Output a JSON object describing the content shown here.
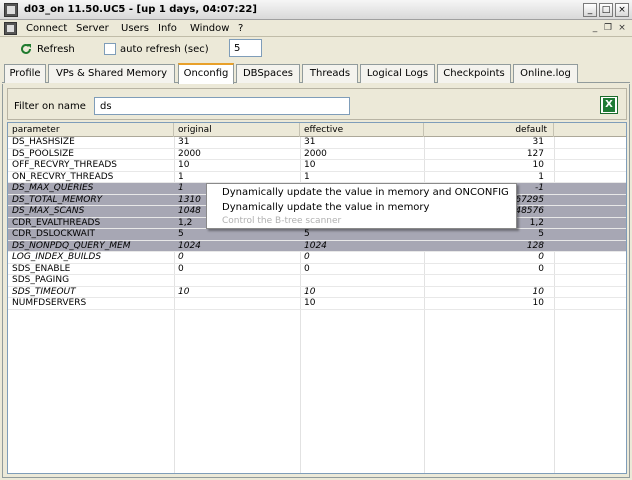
{
  "window": {
    "title": "d03_on 11.50.UC5 - [up 1 days, 04:07:22]"
  },
  "menu": [
    "Connect",
    "Server",
    "Users",
    "Info",
    "Window",
    "?"
  ],
  "toolbar": {
    "refresh_label": "Refresh",
    "auto_refresh_label": "auto refresh (sec)",
    "interval_value": "5"
  },
  "tabs": [
    "Profile",
    "VPs & Shared Memory",
    "Onconfig",
    "DBSpaces",
    "Threads",
    "Logical Logs",
    "Checkpoints",
    "Online.log"
  ],
  "active_tab": "Onconfig",
  "filter": {
    "label": "Filter on name",
    "value": "ds"
  },
  "table": {
    "headers": [
      "parameter",
      "original",
      "effective",
      "default"
    ],
    "rows": [
      [
        "DS_HASHSIZE",
        "31",
        "31",
        "31"
      ],
      [
        "DS_POOLSIZE",
        "2000",
        "2000",
        "127"
      ],
      [
        "OFF_RECVRY_THREADS",
        "10",
        "10",
        "10"
      ],
      [
        "ON_RECVRY_THREADS",
        "1",
        "1",
        "1"
      ],
      [
        "DS_MAX_QUERIES",
        "1",
        "",
        "-1"
      ],
      [
        "DS_TOTAL_MEMORY",
        "1310",
        "",
        "67295"
      ],
      [
        "DS_MAX_SCANS",
        "1048",
        "",
        "48576"
      ],
      [
        "CDR_EVALTHREADS",
        "1,2",
        "",
        "1,2"
      ],
      [
        "CDR_DSLOCKWAIT",
        "5",
        "5",
        "5"
      ],
      [
        "DS_NONPDQ_QUERY_MEM",
        "1024",
        "1024",
        "128"
      ],
      [
        "LOG_INDEX_BUILDS",
        "0",
        "0",
        "0"
      ],
      [
        "SDS_ENABLE",
        "0",
        "0",
        "0"
      ],
      [
        "SDS_PAGING",
        "",
        "",
        ""
      ],
      [
        "SDS_TIMEOUT",
        "10",
        "10",
        "10"
      ],
      [
        "NUMFDSERVERS",
        "",
        "10",
        "10"
      ]
    ]
  },
  "context_menu": {
    "items": [
      "Dynamically update the value in memory and ONCONFIG",
      "Dynamically update the value in memory",
      "Control the B-tree scanner"
    ]
  }
}
